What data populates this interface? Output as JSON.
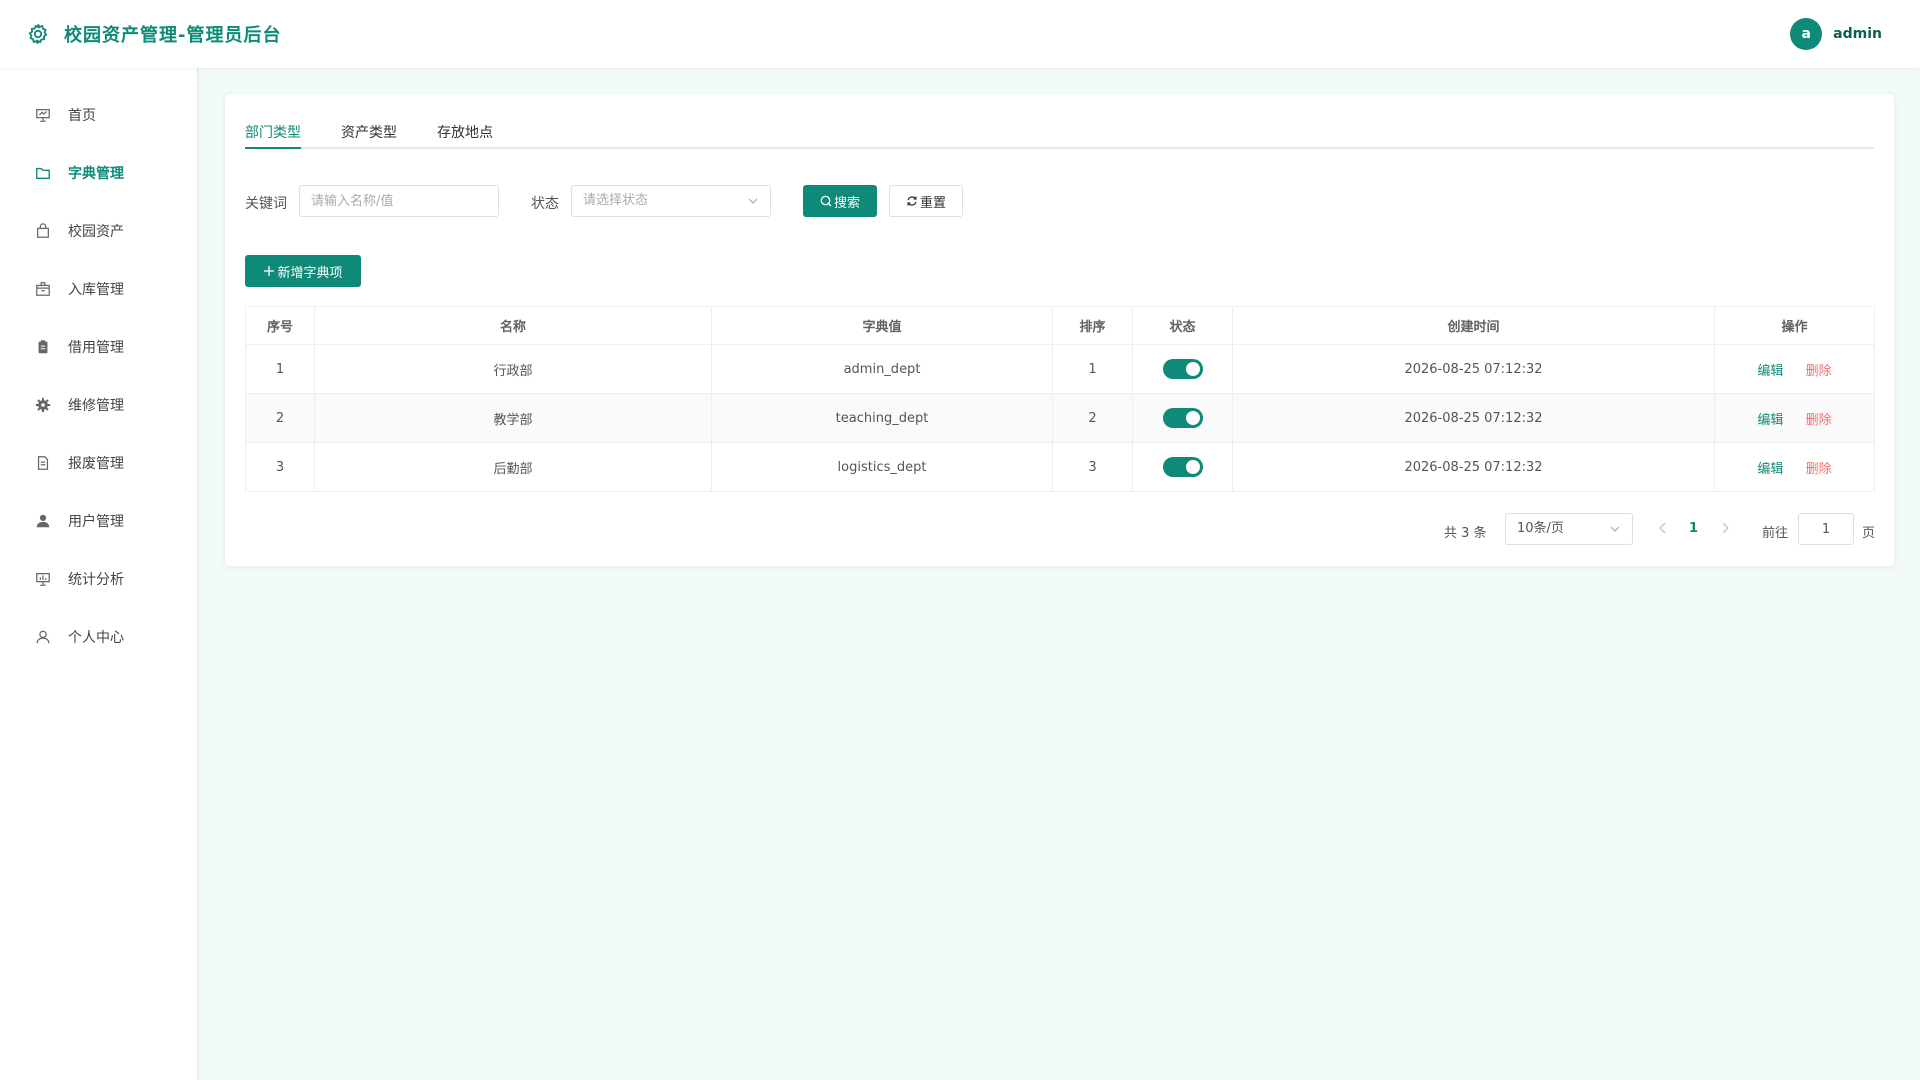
{
  "header": {
    "title": "校园资产管理-管理员后台",
    "avatar_letter": "a",
    "user_name": "admin"
  },
  "sidebar": {
    "items": [
      {
        "label": "首页",
        "icon": "presentation-icon"
      },
      {
        "label": "字典管理",
        "icon": "folder-icon",
        "active": true
      },
      {
        "label": "校园资产",
        "icon": "shopping-bag-icon"
      },
      {
        "label": "入库管理",
        "icon": "box-icon"
      },
      {
        "label": "借用管理",
        "icon": "clipboard-icon"
      },
      {
        "label": "维修管理",
        "icon": "gear-icon"
      },
      {
        "label": "报废管理",
        "icon": "document-icon"
      },
      {
        "label": "用户管理",
        "icon": "user-filled-icon"
      },
      {
        "label": "统计分析",
        "icon": "chart-board-icon"
      },
      {
        "label": "个人中心",
        "icon": "user-outline-icon"
      }
    ]
  },
  "tabs": [
    {
      "label": "部门类型",
      "active": true
    },
    {
      "label": "资产类型"
    },
    {
      "label": "存放地点"
    }
  ],
  "filters": {
    "keyword_label": "关键词",
    "keyword_placeholder": "请输入名称/值",
    "status_label": "状态",
    "status_placeholder": "请选择状态",
    "search_label": "搜索",
    "reset_label": "重置"
  },
  "add_button_label": "新增字典项",
  "table": {
    "columns": [
      "序号",
      "名称",
      "字典值",
      "排序",
      "状态",
      "创建时间",
      "操作"
    ],
    "rows": [
      {
        "index": "1",
        "name": "行政部",
        "value": "admin_dept",
        "sort": "1",
        "status": true,
        "created": "2026-08-25 07:12:32"
      },
      {
        "index": "2",
        "name": "教学部",
        "value": "teaching_dept",
        "sort": "2",
        "status": true,
        "created": "2026-08-25 07:12:32"
      },
      {
        "index": "3",
        "name": "后勤部",
        "value": "logistics_dept",
        "sort": "3",
        "status": true,
        "created": "2026-08-25 07:12:32"
      }
    ],
    "edit_label": "编辑",
    "delete_label": "删除"
  },
  "pagination": {
    "total_text": "共 3 条",
    "page_size": "10条/页",
    "current_page": "1",
    "goto_label": "前往",
    "goto_value": "1",
    "page_suffix": "页"
  },
  "colors": {
    "accent": "#0f8a78",
    "danger": "#f56c6c",
    "background": "#f2fbf8"
  }
}
